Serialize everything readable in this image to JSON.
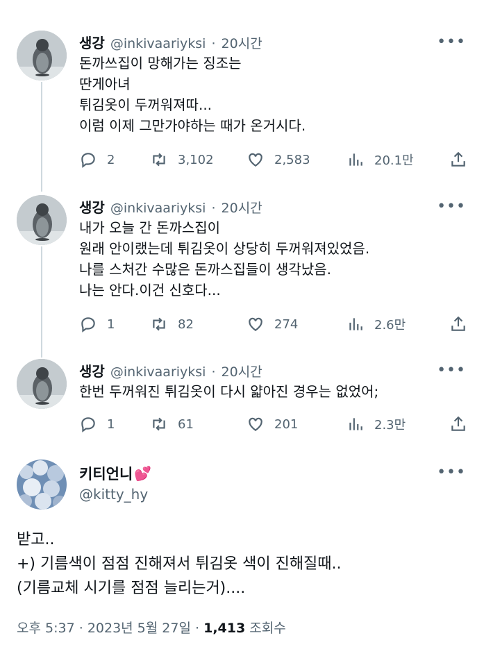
{
  "thread": [
    {
      "name": "생강",
      "handle": "@inkivaariyksi",
      "separator": "·",
      "time": "20시간",
      "lines": [
        "돈까쓰집이 망해가는 징조는",
        "딴게아녀",
        "튀김옷이 두꺼워져따...",
        "이럼 이제 그만가야하는 때가 온거시다."
      ],
      "replies": "2",
      "retweets": "3,102",
      "likes": "2,583",
      "views": "20.1만"
    },
    {
      "name": "생강",
      "handle": "@inkivaariyksi",
      "separator": "·",
      "time": "20시간",
      "lines": [
        "내가 오늘 간 돈까스집이",
        "원래 안이랬는데 튀김옷이 상당히 두꺼워져있었음.",
        "나를 스처간 수많은 돈까스집들이 생각났음.",
        "나는 안다.이건 신호다..."
      ],
      "replies": "1",
      "retweets": "82",
      "likes": "274",
      "views": "2.6만"
    },
    {
      "name": "생강",
      "handle": "@inkivaariyksi",
      "separator": "·",
      "time": "20시간",
      "lines": [
        "한번 두꺼워진 튀김옷이 다시 얇아진 경우는 없었어;"
      ],
      "replies": "1",
      "retweets": "61",
      "likes": "201",
      "views": "2.3만"
    }
  ],
  "main": {
    "name": "키티언니",
    "name_emoji": "💕",
    "handle": "@kitty_hy",
    "lines": [
      "받고..",
      "+) 기름색이 점점 진해져서 튀김옷 색이 진해질때..",
      "(기름교체 시기를 점점 늘리는거)...."
    ],
    "time": "오후 5:37",
    "separator": "·",
    "date": "2023년 5월 27일",
    "views_count": "1,413",
    "views_label": "조회수"
  },
  "icons": {
    "more": "more-icon",
    "reply": "reply-icon",
    "retweet": "retweet-icon",
    "like": "heart-icon",
    "views": "views-icon",
    "share": "share-icon"
  },
  "colors": {
    "text": "#0f1419",
    "secondary": "#536471",
    "thread_line": "#cfd9de",
    "heart_emoji": "#e0245e"
  }
}
